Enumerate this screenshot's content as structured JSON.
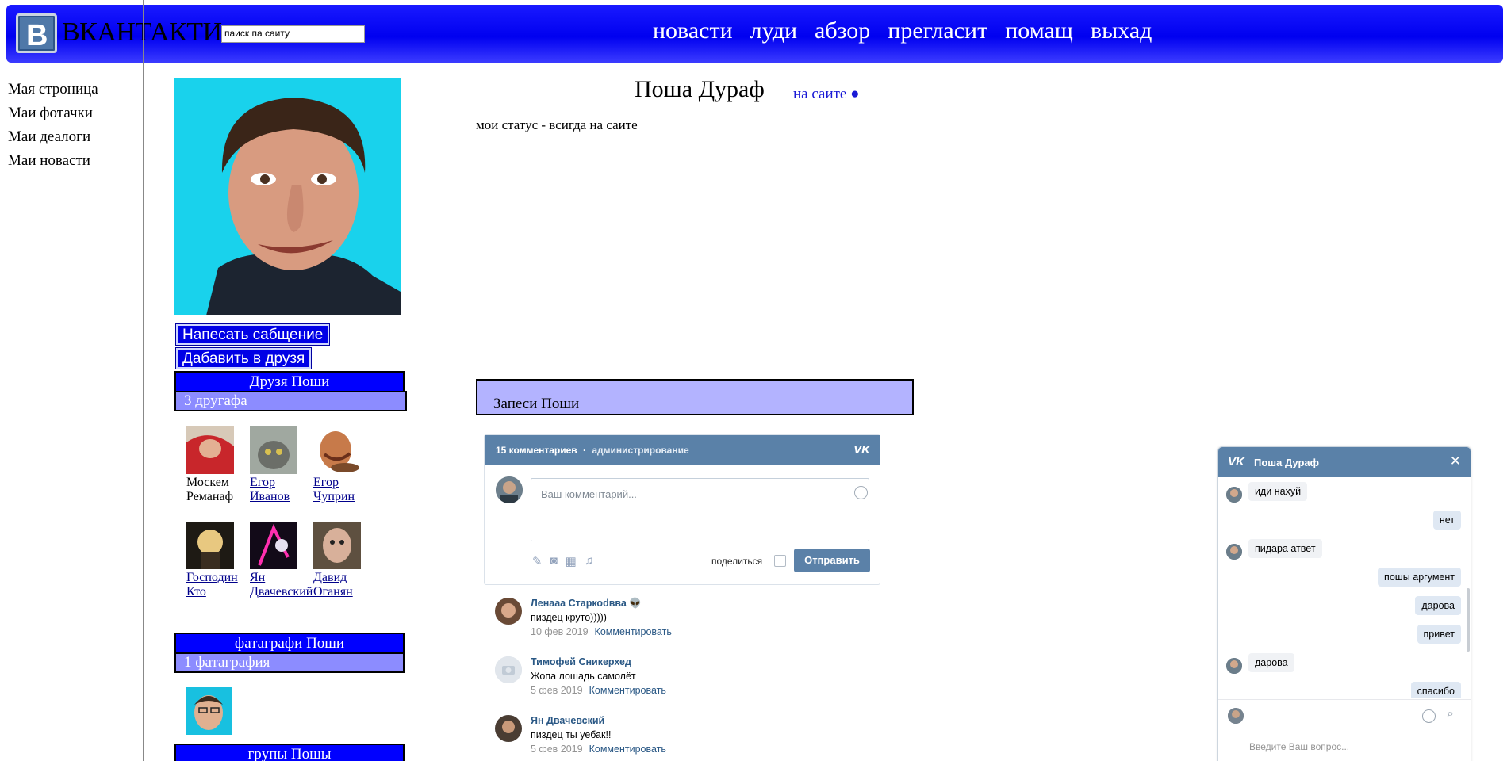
{
  "header": {
    "logo_letter": "В",
    "logo_text": "ВКАНТАКТИ",
    "search_value": "паиск па саиту",
    "nav": [
      "новасти",
      "луди",
      "абзор",
      "преглаcит",
      "помащ",
      "выхад"
    ],
    "colors": {
      "header_blue": "#0000f0"
    }
  },
  "leftmenu": [
    "Мая строница",
    "Маи фотачки",
    "Маи деалоги",
    "Маи новасти"
  ],
  "profile": {
    "name": "Поша Дураф",
    "online": "на саите ●",
    "status": "мои статус - всигда на саите",
    "btn_message": "Напесать сабщение",
    "btn_add": "Дабавить в друзя",
    "friends_title": "Друзя Поши",
    "friends_count": "3 другафа",
    "friends": [
      {
        "first": "Москем",
        "last": "Реманаф",
        "link": false
      },
      {
        "first": "Егор",
        "last": "Иванов",
        "link": true
      },
      {
        "first": "Егор",
        "last": "Чуприн",
        "link": true
      },
      {
        "first": "Господин",
        "last": "Кто",
        "link": true
      },
      {
        "first": "Ян",
        "last": "Двачевский",
        "link": true
      },
      {
        "first": "Давид",
        "last": "Оганян",
        "link": true
      }
    ],
    "photos_title": "фатаграфи Поши",
    "photos_count": "1 фатаграфия",
    "groups_title": "грyпы Пошы",
    "wall_title": "Запеси Поши"
  },
  "comments_widget": {
    "count_label": "15 комментариев",
    "sep": "·",
    "admin_label": "администрирование",
    "vk_mark": "VK",
    "placeholder": "Ваш комментарий...",
    "share_label": "поделиться",
    "send_label": "Отправить",
    "comments": [
      {
        "author": "Ленааа Старкоdвва 👽",
        "text": "пиздец круто)))))",
        "date": "10 фев 2019",
        "action": "Комментировать"
      },
      {
        "author": "Тимофей Сникерхед",
        "text": "Жопа лошадь самолёт",
        "date": "5 фев 2019",
        "action": "Комментировать"
      },
      {
        "author": "Ян Двачевский",
        "text": "пиздец ты уебак!!",
        "date": "5 фев 2019",
        "action": "Комментировать"
      }
    ]
  },
  "chat": {
    "title": "Поша Дураф",
    "vk_mark": "VK",
    "close": "✕",
    "messages": [
      {
        "text": "иди нахуй",
        "dir": "in"
      },
      {
        "text": "нет",
        "dir": "out"
      },
      {
        "text": "пидара атвет",
        "dir": "in"
      },
      {
        "text": "пошы аргумент",
        "dir": "out"
      },
      {
        "text": "дарова",
        "dir": "out"
      },
      {
        "text": "привет",
        "dir": "out"
      },
      {
        "text": "дарова",
        "dir": "in"
      },
      {
        "text": "спасибо",
        "dir": "out"
      }
    ],
    "input_placeholder": "Введите Ваш вопрос..."
  }
}
